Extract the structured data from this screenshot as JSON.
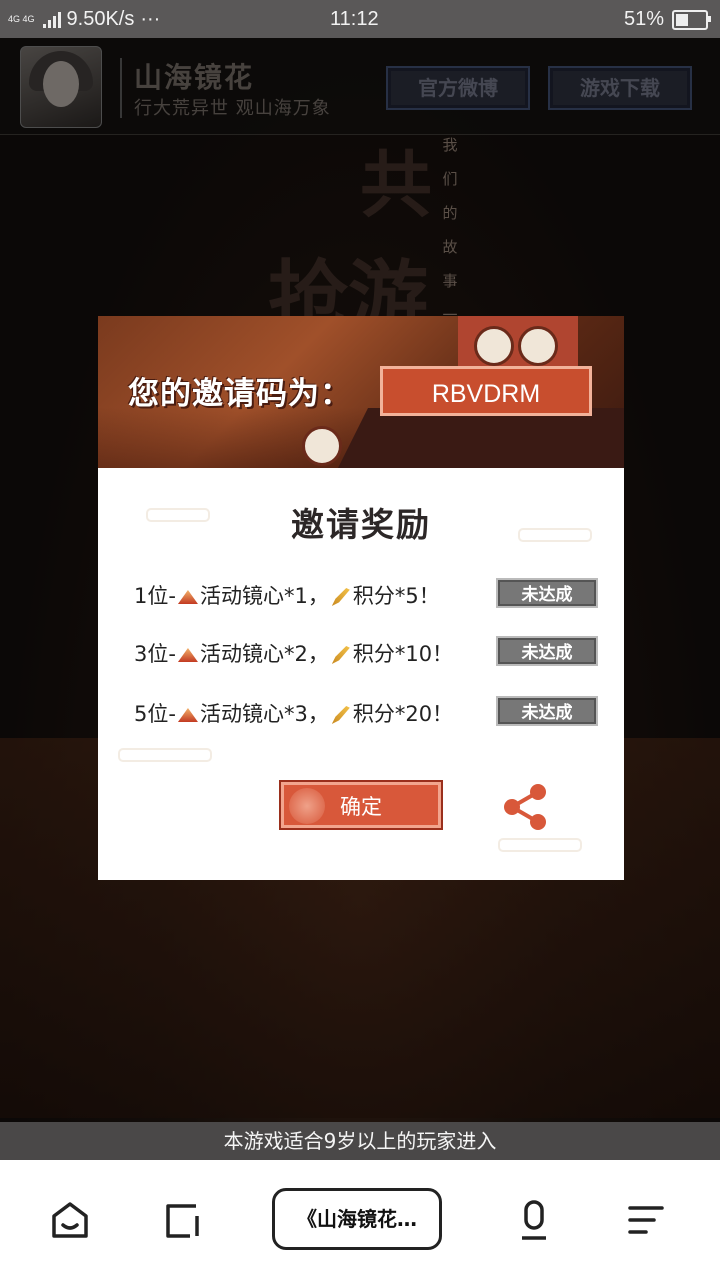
{
  "status_bar": {
    "network": "4G 4G",
    "speed": "9.50K/s",
    "dots": "···",
    "time": "11:12",
    "battery": "51%",
    "battery_level": 0.51
  },
  "header": {
    "title": "山海镜花",
    "slogan": "行大荒异世 观山海万象",
    "weibo_button": "官方微博",
    "download_button": "游戏下载"
  },
  "background": {
    "big_chars": [
      "共",
      "抢游"
    ],
    "vertical_text": "我们的故事一"
  },
  "modal": {
    "invite_label": "您的邀请码为：",
    "invite_code": "RBVDRM",
    "rewards_title": "邀请奖励",
    "rows": [
      {
        "prefix": "1位-",
        "item1": "活动镜心*1，",
        "item2": "积分*5！",
        "status": "未达成"
      },
      {
        "prefix": "3位-",
        "item1": "活动镜心*2，",
        "item2": "积分*10！",
        "status": "未达成"
      },
      {
        "prefix": "5位-",
        "item1": "活动镜心*3，",
        "item2": "积分*20！",
        "status": "未达成"
      }
    ],
    "confirm_button": "确定"
  },
  "notice": "本游戏适合9岁以上的玩家进入",
  "toolbar": {
    "tab_title": "《山海镜花…"
  },
  "colors": {
    "accent": "#d8583a",
    "badge_gray": "#777777"
  }
}
